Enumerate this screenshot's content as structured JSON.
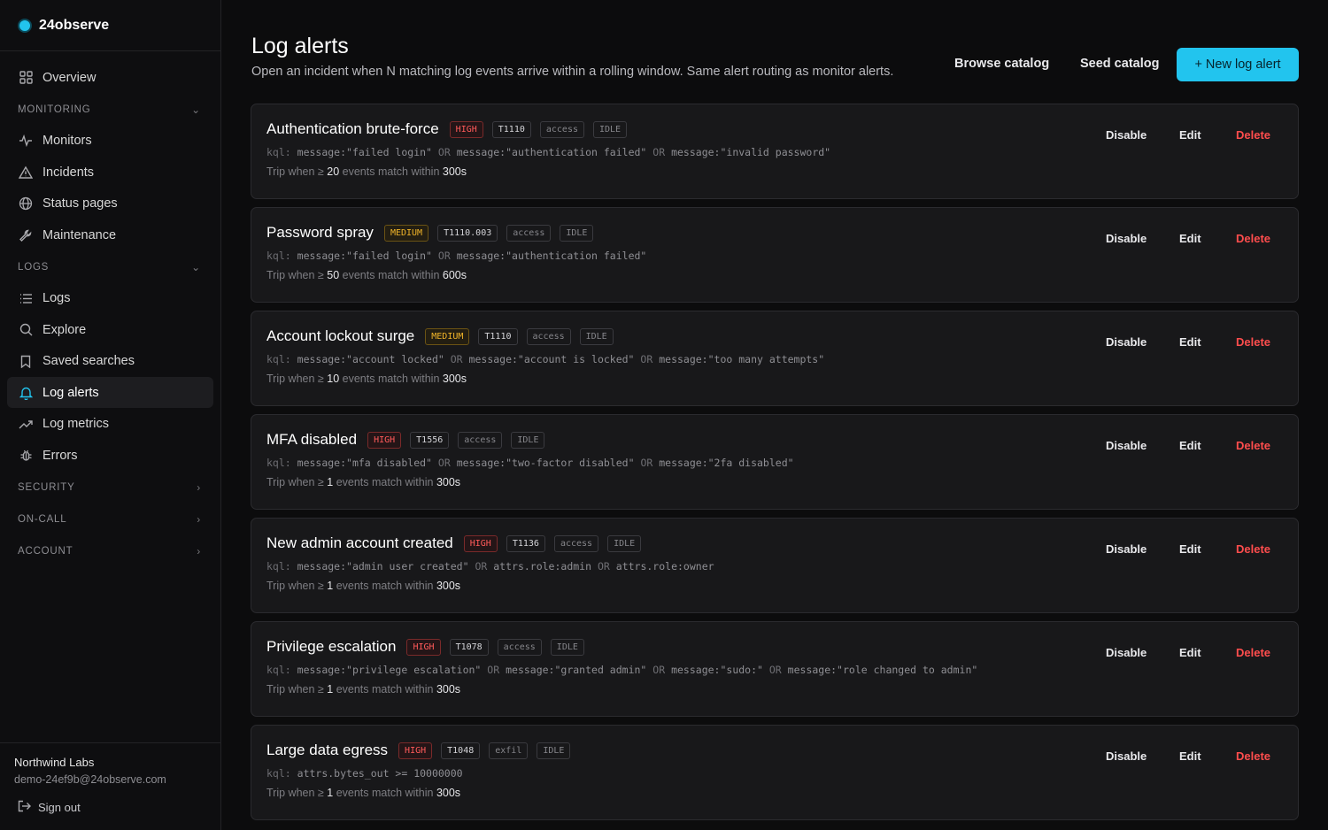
{
  "brand": {
    "name": "24observe",
    "accent": "#22c4ee"
  },
  "sidebar": {
    "overview": "Overview",
    "monitoring": {
      "title": "MONITORING",
      "items": [
        "Monitors",
        "Incidents",
        "Status pages",
        "Maintenance"
      ]
    },
    "logs": {
      "title": "LOGS",
      "items": [
        "Logs",
        "Explore",
        "Saved searches",
        "Log alerts",
        "Log metrics",
        "Errors"
      ],
      "active": "Log alerts"
    },
    "collapsed_sections": [
      "SECURITY",
      "ON-CALL",
      "ACCOUNT"
    ],
    "footer": {
      "org": "Northwind Labs",
      "email": "demo-24ef9b@24observe.com",
      "sign_out": "Sign out"
    }
  },
  "header": {
    "title": "Log alerts",
    "subtitle": "Open an incident when N matching log events arrive within a rolling window. Same alert routing as monitor alerts.",
    "browse_catalog": "Browse catalog",
    "seed_catalog": "Seed catalog",
    "new_alert": "+ New log alert"
  },
  "card_actions": {
    "disable": "Disable",
    "edit": "Edit",
    "delete": "Delete"
  },
  "trip": {
    "prefix": "Trip when ≥",
    "mid": "events match within"
  },
  "alerts": [
    {
      "title": "Authentication brute-force",
      "severity": "HIGH",
      "technique": "T1110",
      "category": "access",
      "state": "IDLE",
      "kql_prefix": "kql:",
      "kql": [
        "message:\"failed login\"",
        "OR",
        "message:\"authentication failed\"",
        "OR",
        "message:\"invalid password\""
      ],
      "threshold": "20",
      "window": "300s"
    },
    {
      "title": "Password spray",
      "severity": "MEDIUM",
      "technique": "T1110.003",
      "category": "access",
      "state": "IDLE",
      "kql_prefix": "kql:",
      "kql": [
        "message:\"failed login\"",
        "OR",
        "message:\"authentication failed\""
      ],
      "threshold": "50",
      "window": "600s"
    },
    {
      "title": "Account lockout surge",
      "severity": "MEDIUM",
      "technique": "T1110",
      "category": "access",
      "state": "IDLE",
      "kql_prefix": "kql:",
      "kql": [
        "message:\"account locked\"",
        "OR",
        "message:\"account is locked\"",
        "OR",
        "message:\"too many attempts\""
      ],
      "threshold": "10",
      "window": "300s"
    },
    {
      "title": "MFA disabled",
      "severity": "HIGH",
      "technique": "T1556",
      "category": "access",
      "state": "IDLE",
      "kql_prefix": "kql:",
      "kql": [
        "message:\"mfa disabled\"",
        "OR",
        "message:\"two-factor disabled\"",
        "OR",
        "message:\"2fa disabled\""
      ],
      "threshold": "1",
      "window": "300s"
    },
    {
      "title": "New admin account created",
      "severity": "HIGH",
      "technique": "T1136",
      "category": "access",
      "state": "IDLE",
      "kql_prefix": "kql:",
      "kql": [
        "message:\"admin user created\"",
        "OR",
        "attrs.role:admin",
        "OR",
        "attrs.role:owner"
      ],
      "threshold": "1",
      "window": "300s"
    },
    {
      "title": "Privilege escalation",
      "severity": "HIGH",
      "technique": "T1078",
      "category": "access",
      "state": "IDLE",
      "kql_prefix": "kql:",
      "kql": [
        "message:\"privilege escalation\"",
        "OR",
        "message:\"granted admin\"",
        "OR",
        "message:\"sudo:\"",
        "OR",
        "message:\"role changed to admin\""
      ],
      "threshold": "1",
      "window": "300s"
    },
    {
      "title": "Large data egress",
      "severity": "HIGH",
      "technique": "T1048",
      "category": "exfil",
      "state": "IDLE",
      "kql_prefix": "kql:",
      "kql": [
        "attrs.bytes_out >= 10000000"
      ],
      "threshold": "1",
      "window": "300s"
    }
  ],
  "colors": {
    "high": "#ff5a5a",
    "medium": "#f0b429",
    "delete": "#ff4d4d"
  }
}
